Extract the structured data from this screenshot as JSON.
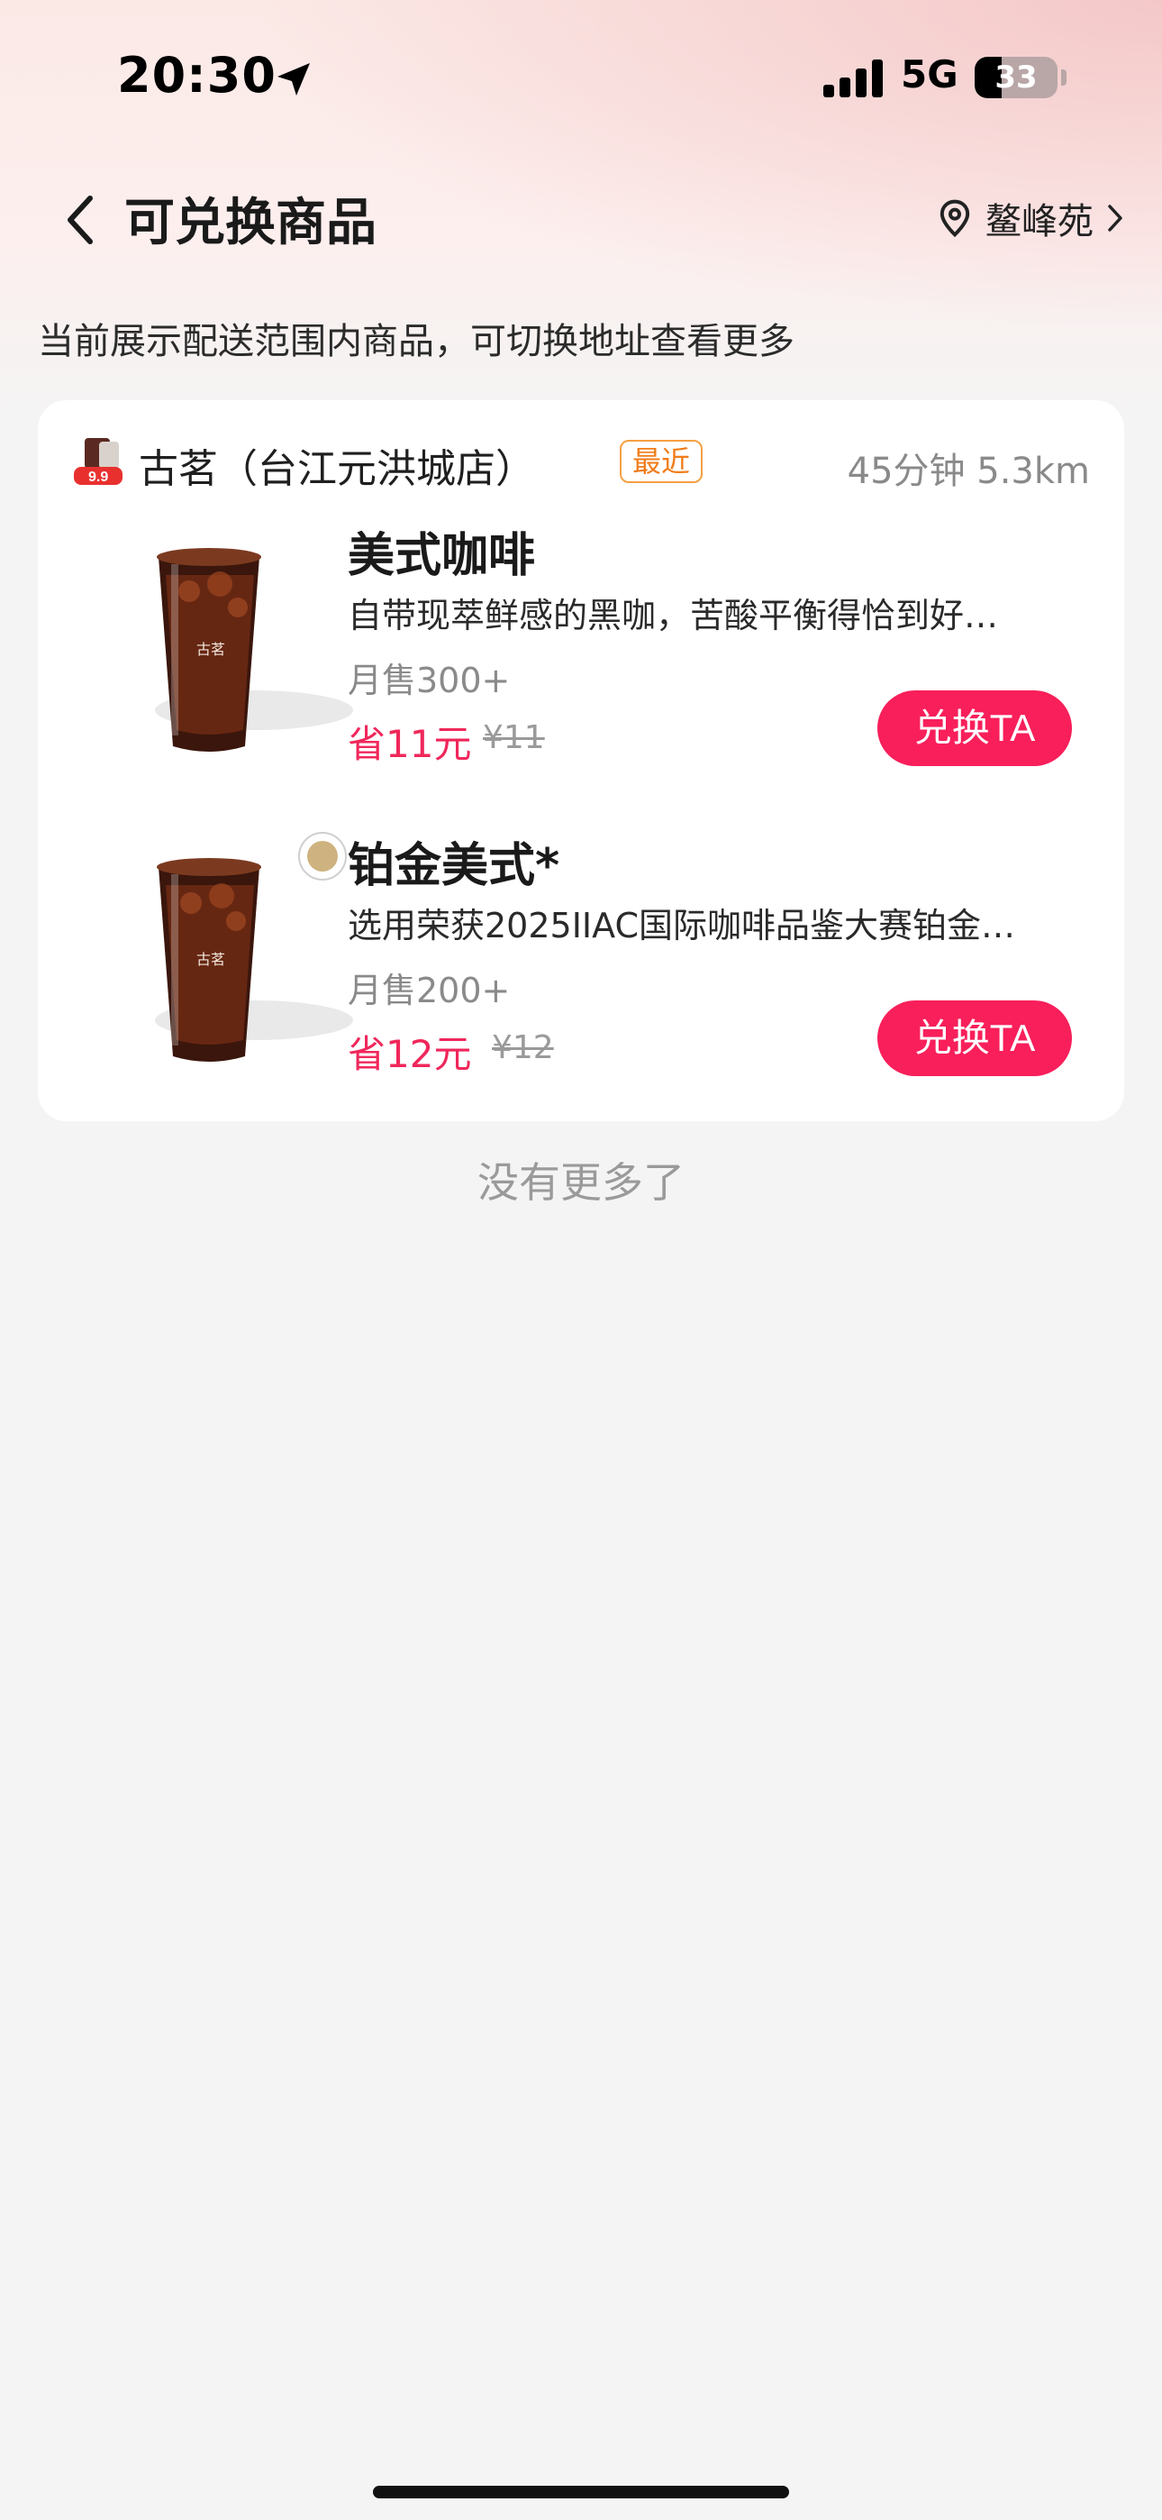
{
  "status_bar": {
    "time": "20:30",
    "network": "5G",
    "battery": "33",
    "battery_level": 0.33,
    "icons": [
      "location-arrow-icon",
      "signal-icon",
      "battery-icon"
    ]
  },
  "header": {
    "title": "可兑换商品",
    "address": "鳌峰苑",
    "icons": [
      "chevron-left-icon",
      "location-pin-icon",
      "chevron-right-icon"
    ]
  },
  "hint": "当前展示配送范围内商品，可切换地址查看更多",
  "store": {
    "name": "古茗（台江元洪城店）",
    "badge": "最近",
    "meta": "45分钟 5.3km",
    "logo_text": "9.9",
    "products": [
      {
        "name": "美式咖啡",
        "desc": "自带现萃鲜感的黑咖，苦酸平衡得恰到好…",
        "sales": "月售300+",
        "save": "省11元",
        "orig_price": "¥11",
        "button": "兑换TA",
        "cup_text": "古茗"
      },
      {
        "name": "铂金美式*",
        "desc": "选用荣获2025IIAC国际咖啡品鉴大赛铂金…",
        "sales": "月售200+",
        "save": "省12元",
        "orig_price": "¥12",
        "button": "兑换TA",
        "cup_text": "古茗"
      }
    ]
  },
  "footer": {
    "no_more": "没有更多了"
  },
  "colors": {
    "accent": "#f81f5b",
    "price": "#f0275b",
    "badge": "#f07d1a",
    "background": "#f4f4f4"
  }
}
